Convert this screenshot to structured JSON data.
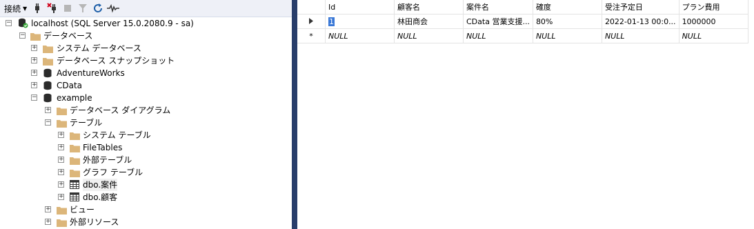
{
  "toolbar": {
    "connect_label": "接続",
    "icons": [
      "connect-plug-icon",
      "disconnect-icon",
      "stop-icon",
      "filter-icon",
      "refresh-icon",
      "activity-monitor-icon"
    ]
  },
  "tree": {
    "server": "localhost (SQL Server 15.0.2080.9 - sa)",
    "databases": "データベース",
    "system_databases": "システム データベース",
    "snapshots": "データベース スナップショット",
    "adventureworks": "AdventureWorks",
    "cdata": "CData",
    "example": "example",
    "diagrams": "データベース ダイアグラム",
    "tables": "テーブル",
    "system_tables": "システム テーブル",
    "filetables": "FileTables",
    "external_tables": "外部テーブル",
    "graph_tables": "グラフ テーブル",
    "table1": "dbo.案件",
    "table2": "dbo.顧客",
    "views": "ビュー",
    "external_resources": "外部リソース"
  },
  "grid": {
    "columns": [
      "Id",
      "顧客名",
      "案件名",
      "確度",
      "受注予定日",
      "プラン費用"
    ],
    "row1": [
      "1",
      "林田商会",
      "CData 営業支援...",
      "80%",
      "2022-01-13 00:0...",
      "1000000"
    ],
    "row2": [
      "NULL",
      "NULL",
      "NULL",
      "NULL",
      "NULL",
      "NULL"
    ],
    "row2_marker": "*"
  },
  "colors": {
    "splitter": "#283d6a",
    "folder": "#dcb67a",
    "selection": "#3a78d6"
  }
}
